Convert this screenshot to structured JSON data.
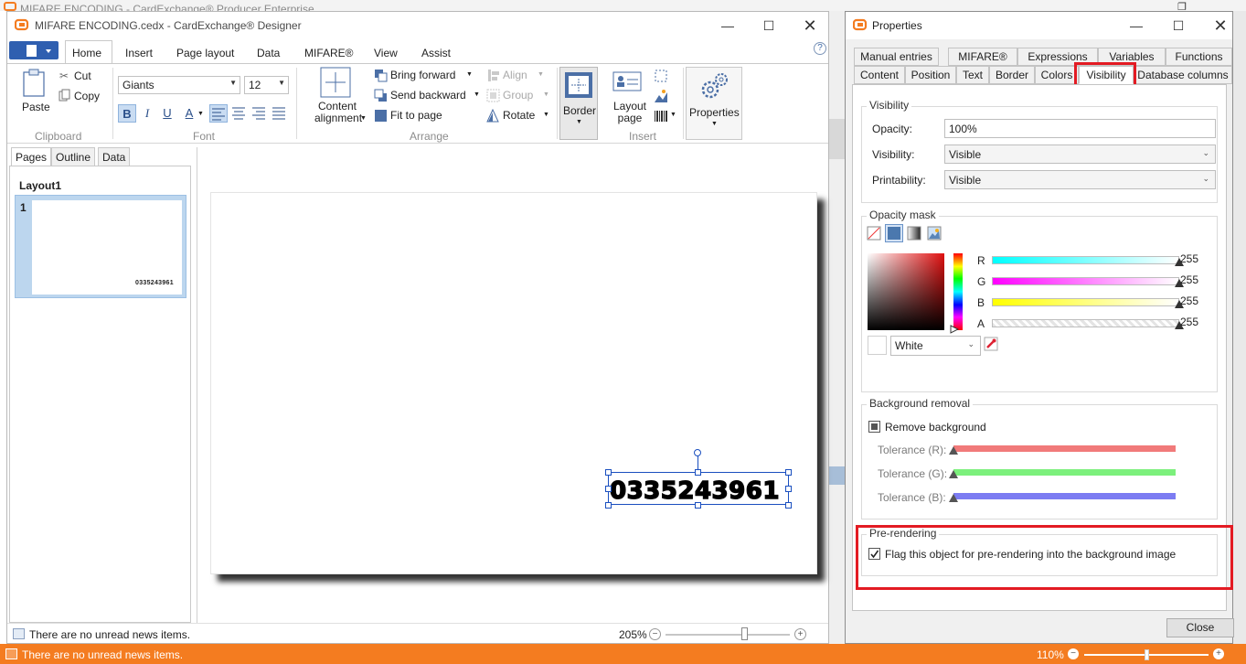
{
  "background_app": {
    "title": "MIFARE ENCODING - CardExchange® Producer Enterprise",
    "status_news": "There are no unread news items.",
    "zoom": "110%",
    "zoom_slider_fraction": 0.48,
    "accent_color": "#f47c20"
  },
  "designer": {
    "title": "MIFARE ENCODING.cedx - CardExchange® Designer",
    "window_controls": [
      "minimize",
      "maximize",
      "close"
    ],
    "tabs": [
      "Home",
      "Insert",
      "Page layout",
      "Data",
      "MIFARE®",
      "View",
      "Assist"
    ],
    "active_tab": "Home",
    "help_label": "?",
    "clipboard": {
      "paste": "Paste",
      "cut": "Cut",
      "copy": "Copy",
      "group": "Clipboard"
    },
    "font": {
      "family": "Giants",
      "size": "12",
      "group": "Font",
      "buttons": [
        "B",
        "I",
        "U",
        "A"
      ]
    },
    "content_alignment": "Content alignment",
    "arrange": {
      "bring_forward": "Bring forward",
      "send_backward": "Send backward",
      "fit_to_page": "Fit to page",
      "align": "Align",
      "group_btn": "Group",
      "rotate": "Rotate",
      "group": "Arrange"
    },
    "border": "Border",
    "insert": {
      "layout_page": "Layout page",
      "group": "Insert"
    },
    "properties": "Properties",
    "left_tabs": [
      "Pages",
      "Outline",
      "Data"
    ],
    "active_left_tab": "Pages",
    "layout_name": "Layout1",
    "page_number": "1",
    "card_text": "0335243961",
    "status_news": "There are no unread news items.",
    "zoom": "205%",
    "zoom_slider_fraction": 0.6
  },
  "properties_dialog": {
    "title": "Properties",
    "tabs_row1": [
      "Manual entries",
      "MIFARE®",
      "Expressions",
      "Variables",
      "Functions"
    ],
    "tabs_row2": [
      "Content",
      "Position",
      "Text",
      "Border",
      "Colors",
      "Visibility",
      "Database columns"
    ],
    "active_tab": "Visibility",
    "visibility_group": {
      "caption": "Visibility",
      "opacity_label": "Opacity:",
      "opacity_value": "100%",
      "visibility_label": "Visibility:",
      "visibility_value": "Visible",
      "printability_label": "Printability:",
      "printability_value": "Visible"
    },
    "opacity_mask": {
      "caption": "Opacity mask",
      "channels": [
        {
          "label": "R",
          "value": "255"
        },
        {
          "label": "G",
          "value": "255"
        },
        {
          "label": "B",
          "value": "255"
        },
        {
          "label": "A",
          "value": "255"
        }
      ],
      "color_name": "White"
    },
    "background_removal": {
      "caption": "Background removal",
      "checkbox_label": "Remove background",
      "tolerances": [
        "Tolerance (R):",
        "Tolerance (G):",
        "Tolerance (B):"
      ]
    },
    "pre_rendering": {
      "caption": "Pre-rendering",
      "checkbox_label": "Flag this object for pre-rendering into the background image",
      "checked": true
    },
    "close_label": "Close",
    "highlight_color": "#e31b23"
  }
}
